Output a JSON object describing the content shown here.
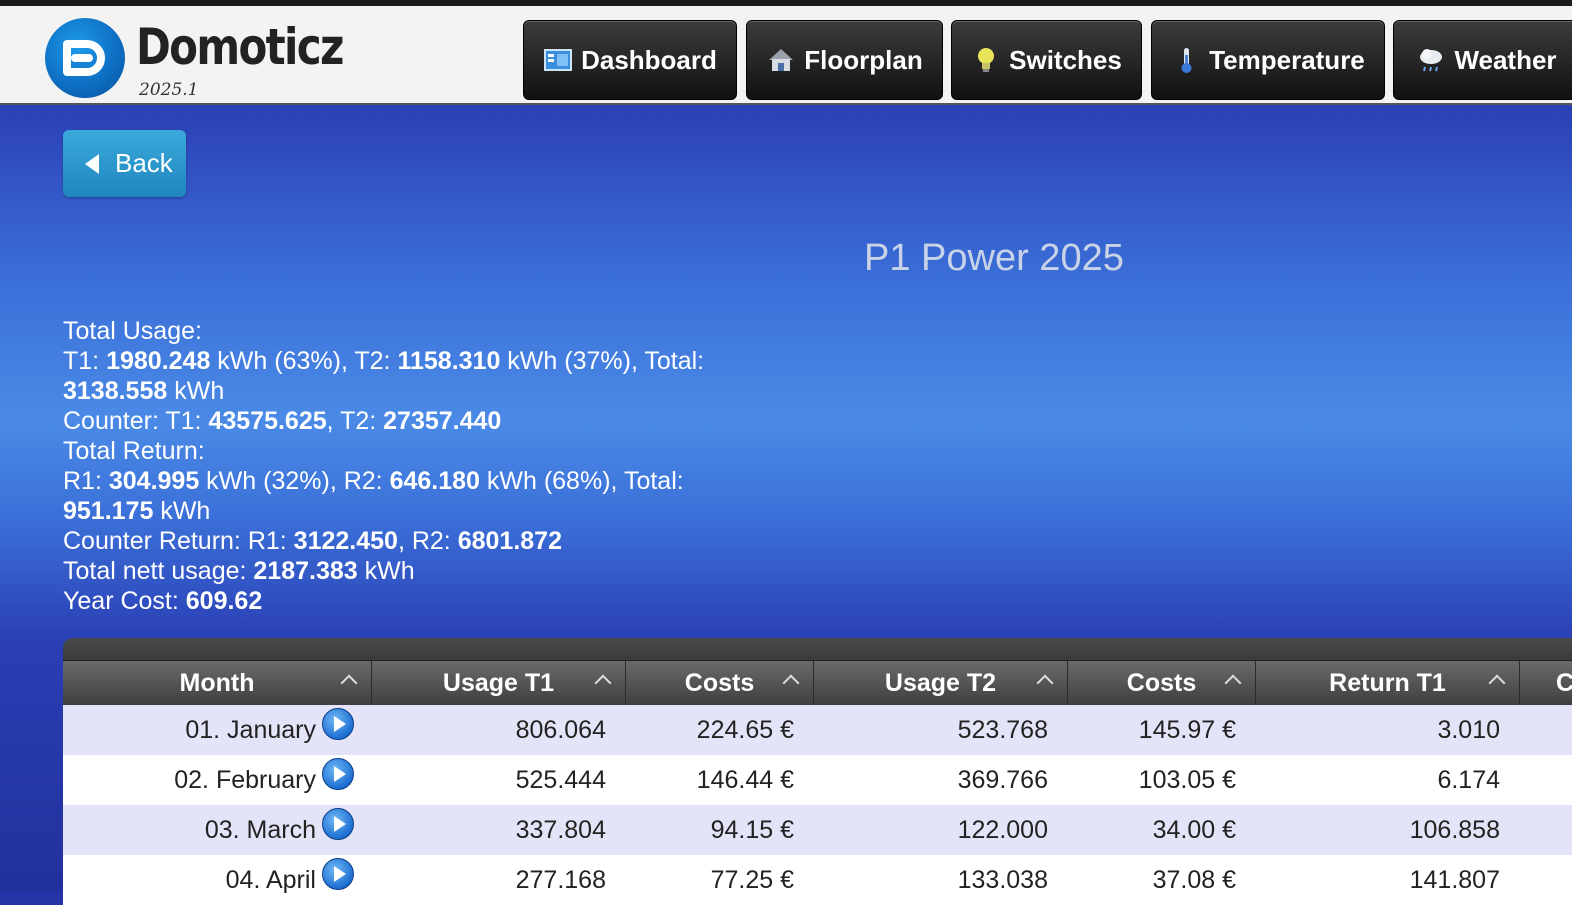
{
  "header": {
    "brand": "Domoticz",
    "version": "2025.1",
    "nav": [
      {
        "label": "Dashboard",
        "icon": "dashboard-icon"
      },
      {
        "label": "Floorplan",
        "icon": "house-icon"
      },
      {
        "label": "Switches",
        "icon": "lightbulb-icon"
      },
      {
        "label": "Temperature",
        "icon": "thermometer-icon"
      },
      {
        "label": "Weather",
        "icon": "rain-cloud-icon"
      }
    ]
  },
  "back_label": "Back",
  "page_title": "P1 Power 2025",
  "summary": {
    "total_usage_label": "Total Usage:",
    "t1_prefix": "T1: ",
    "t1_value": "1980.248",
    "t1_suffix": " kWh (63%), T2: ",
    "t2_value": "1158.310",
    "t2_suffix": " kWh (37%), Total:",
    "total_value": "3138.558",
    "kwh": " kWh",
    "counter_prefix": "Counter: T1: ",
    "counter_t1": "43575.625",
    "counter_mid": ", T2: ",
    "counter_t2": "27357.440",
    "total_return_label": "Total Return:",
    "r1_prefix": "R1: ",
    "r1_value": "304.995",
    "r1_suffix": " kWh (32%), R2: ",
    "r2_value": "646.180",
    "r2_suffix": " kWh (68%), Total:",
    "return_total": "951.175",
    "counter_return_prefix": "Counter Return: R1: ",
    "counter_r1": "3122.450",
    "counter_return_mid": ", R2: ",
    "counter_r2": "6801.872",
    "nett_prefix": "Total nett usage: ",
    "nett_value": "2187.383",
    "year_cost_prefix": "Year Cost: ",
    "year_cost_value": "609.62"
  },
  "table": {
    "columns": [
      "Month",
      "Usage T1",
      "Costs",
      "Usage T2",
      "Costs",
      "Return T1",
      "C"
    ],
    "rows": [
      {
        "month": "01. January",
        "usage_t1": "806.064",
        "costs_t1": "224.65 €",
        "usage_t2": "523.768",
        "costs_t2": "145.97 €",
        "return_t1": "3.010"
      },
      {
        "month": "02. February",
        "usage_t1": "525.444",
        "costs_t1": "146.44 €",
        "usage_t2": "369.766",
        "costs_t2": "103.05 €",
        "return_t1": "6.174"
      },
      {
        "month": "03. March",
        "usage_t1": "337.804",
        "costs_t1": "94.15 €",
        "usage_t2": "122.000",
        "costs_t2": "34.00 €",
        "return_t1": "106.858"
      },
      {
        "month": "04. April",
        "usage_t1": "277.168",
        "costs_t1": "77.25 €",
        "usage_t2": "133.038",
        "costs_t2": "37.08 €",
        "return_t1": "141.807"
      }
    ]
  }
}
